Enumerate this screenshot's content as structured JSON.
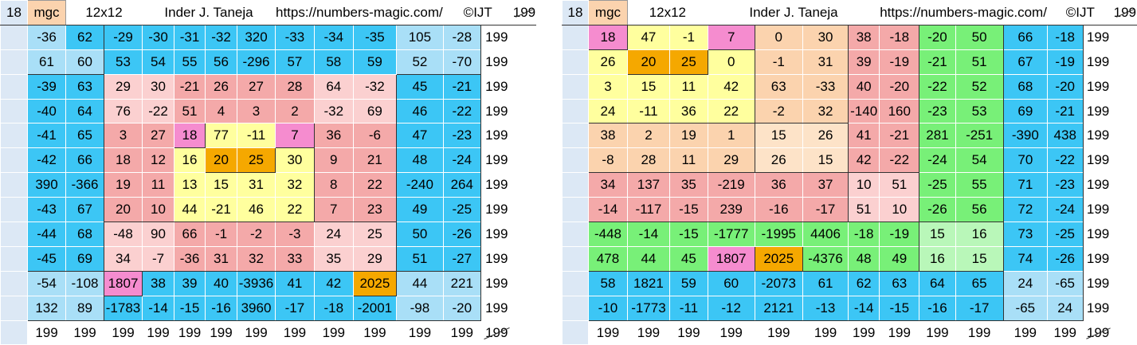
{
  "colors": {
    "cyan": "#3cc6f5",
    "lightblue": "#a9dff7",
    "pink": "#f4a9a9",
    "lightpink": "#fbd0d0",
    "yellow": "#ffff9e",
    "orange": "#f5a800",
    "magenta": "#f58ccf",
    "peach": "#fbd3ae",
    "green": "#78f078",
    "lightgreen": "#b9f7b9",
    "white": "#ffffff",
    "side": "#dce8f5"
  },
  "left": {
    "header": [
      "18",
      "mgc",
      "12x12",
      "Inder J. Taneja",
      "https://numbers-magic.com/",
      "©IJT",
      "199"
    ],
    "rows": [
      [
        -36,
        62,
        -29,
        -30,
        -31,
        -32,
        320,
        -33,
        -34,
        -35,
        105,
        -28
      ],
      [
        61,
        60,
        53,
        54,
        55,
        56,
        -296,
        57,
        58,
        59,
        52,
        -70
      ],
      [
        -39,
        63,
        29,
        30,
        -21,
        26,
        27,
        28,
        64,
        -32,
        45,
        -21
      ],
      [
        -40,
        64,
        76,
        -22,
        51,
        4,
        3,
        2,
        -32,
        69,
        46,
        -22
      ],
      [
        -41,
        65,
        3,
        27,
        18,
        77,
        -11,
        7,
        36,
        -6,
        47,
        -23
      ],
      [
        -42,
        66,
        18,
        12,
        16,
        20,
        25,
        30,
        9,
        21,
        48,
        -24
      ],
      [
        390,
        -366,
        19,
        11,
        13,
        15,
        31,
        32,
        8,
        22,
        -240,
        264
      ],
      [
        -43,
        67,
        20,
        10,
        44,
        -21,
        46,
        22,
        7,
        23,
        49,
        -25
      ],
      [
        -44,
        68,
        -48,
        90,
        66,
        -1,
        -2,
        -3,
        24,
        25,
        50,
        -26
      ],
      [
        -45,
        69,
        34,
        -7,
        -36,
        31,
        32,
        33,
        35,
        29,
        51,
        -27
      ],
      [
        -54,
        -108,
        1807,
        38,
        39,
        40,
        -3936,
        41,
        42,
        2025,
        44,
        221
      ],
      [
        132,
        89,
        -1783,
        -14,
        -15,
        -16,
        3960,
        -17,
        -18,
        -2001,
        -98,
        -20
      ]
    ],
    "row_sums": [
      "199",
      "199",
      "199",
      "199",
      "199",
      "199",
      "199",
      "199",
      "199",
      "199",
      "199",
      "199"
    ],
    "col_sums": [
      "199",
      "199",
      "199",
      "199",
      "199",
      "199",
      "199",
      "199",
      "199",
      "199",
      "199",
      "199",
      "199"
    ]
  },
  "right": {
    "header": [
      "18",
      "mgc",
      "12x12",
      "Inder J. Taneja",
      "https://numbers-magic.com/",
      "©IJT",
      "199"
    ],
    "rows": [
      [
        18,
        47,
        -1,
        7,
        0,
        30,
        38,
        -18,
        -20,
        50,
        66,
        -18
      ],
      [
        26,
        20,
        25,
        0,
        -1,
        31,
        39,
        -19,
        -21,
        51,
        67,
        -19
      ],
      [
        3,
        15,
        11,
        42,
        63,
        -33,
        40,
        -20,
        -22,
        52,
        68,
        -20
      ],
      [
        24,
        -11,
        36,
        22,
        -2,
        32,
        -140,
        160,
        -23,
        53,
        69,
        -21
      ],
      [
        38,
        2,
        19,
        1,
        15,
        26,
        41,
        -21,
        281,
        -251,
        -390,
        438
      ],
      [
        -8,
        28,
        11,
        29,
        26,
        15,
        42,
        -22,
        -24,
        54,
        70,
        -22
      ],
      [
        34,
        137,
        35,
        -219,
        36,
        37,
        10,
        51,
        -25,
        55,
        71,
        -23
      ],
      [
        -14,
        -117,
        -15,
        239,
        -16,
        -17,
        51,
        10,
        -26,
        56,
        72,
        -24
      ],
      [
        -448,
        -14,
        -15,
        -1777,
        -1995,
        4406,
        -18,
        -19,
        15,
        16,
        73,
        -25
      ],
      [
        478,
        44,
        45,
        1807,
        2025,
        -4376,
        48,
        49,
        16,
        15,
        74,
        -26
      ],
      [
        58,
        1821,
        59,
        60,
        -2073,
        61,
        62,
        63,
        64,
        65,
        24,
        -65
      ],
      [
        -10,
        -1773,
        -11,
        -12,
        2121,
        -13,
        -14,
        -15,
        -16,
        -17,
        -65,
        24
      ]
    ],
    "row_sums": [
      "199",
      "199",
      "199",
      "199",
      "199",
      "199",
      "199",
      "199",
      "199",
      "199",
      "199",
      "199"
    ],
    "col_sums": [
      "199",
      "199",
      "199",
      "199",
      "199",
      "199",
      "199",
      "199",
      "199",
      "199",
      "199",
      "199",
      "199"
    ]
  }
}
